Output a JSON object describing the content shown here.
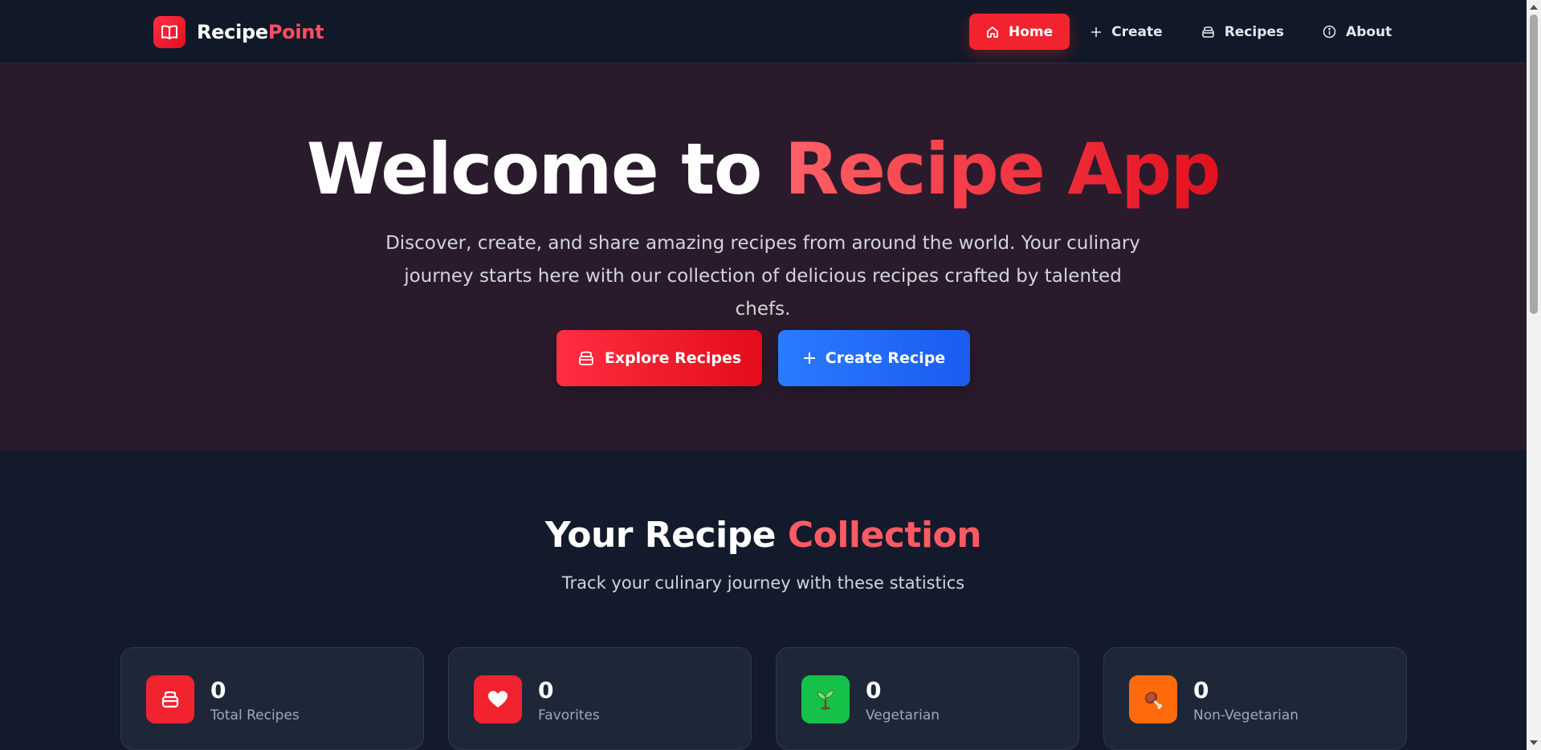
{
  "brand": {
    "name_part1": "Recipe",
    "name_part2": "Point"
  },
  "nav": {
    "items": [
      {
        "label": "Home",
        "icon": "home-icon",
        "active": true
      },
      {
        "label": "Create",
        "icon": "plus-icon",
        "active": false
      },
      {
        "label": "Recipes",
        "icon": "pot-icon",
        "active": false
      },
      {
        "label": "About",
        "icon": "info-icon",
        "active": false
      }
    ]
  },
  "hero": {
    "title_part1": "Welcome to ",
    "title_part2": "Recipe App",
    "subtitle": "Discover, create, and share amazing recipes from around the world. Your culinary journey starts here with our collection of delicious recipes crafted by talented chefs.",
    "explore_label": "Explore Recipes",
    "create_label": "Create Recipe"
  },
  "stats": {
    "title_part1": "Your Recipe ",
    "title_part2": "Collection",
    "subtitle": "Track your culinary journey with these statistics",
    "cards": [
      {
        "value": "0",
        "label": "Total Recipes",
        "icon": "pot-icon",
        "color": "#f1232f"
      },
      {
        "value": "0",
        "label": "Favorites",
        "icon": "heart-icon",
        "color": "#f1232f"
      },
      {
        "value": "0",
        "label": "Vegetarian",
        "icon": "seedling-icon",
        "color": "#16c14a"
      },
      {
        "value": "0",
        "label": "Non-Vegetarian",
        "icon": "meat-icon",
        "color": "#ff6a0c"
      }
    ]
  },
  "colors": {
    "accent_red": "#f1232f",
    "accent_blue": "#1f66f5",
    "background": "#131a2b",
    "hero_background": "#2a1b2c"
  }
}
